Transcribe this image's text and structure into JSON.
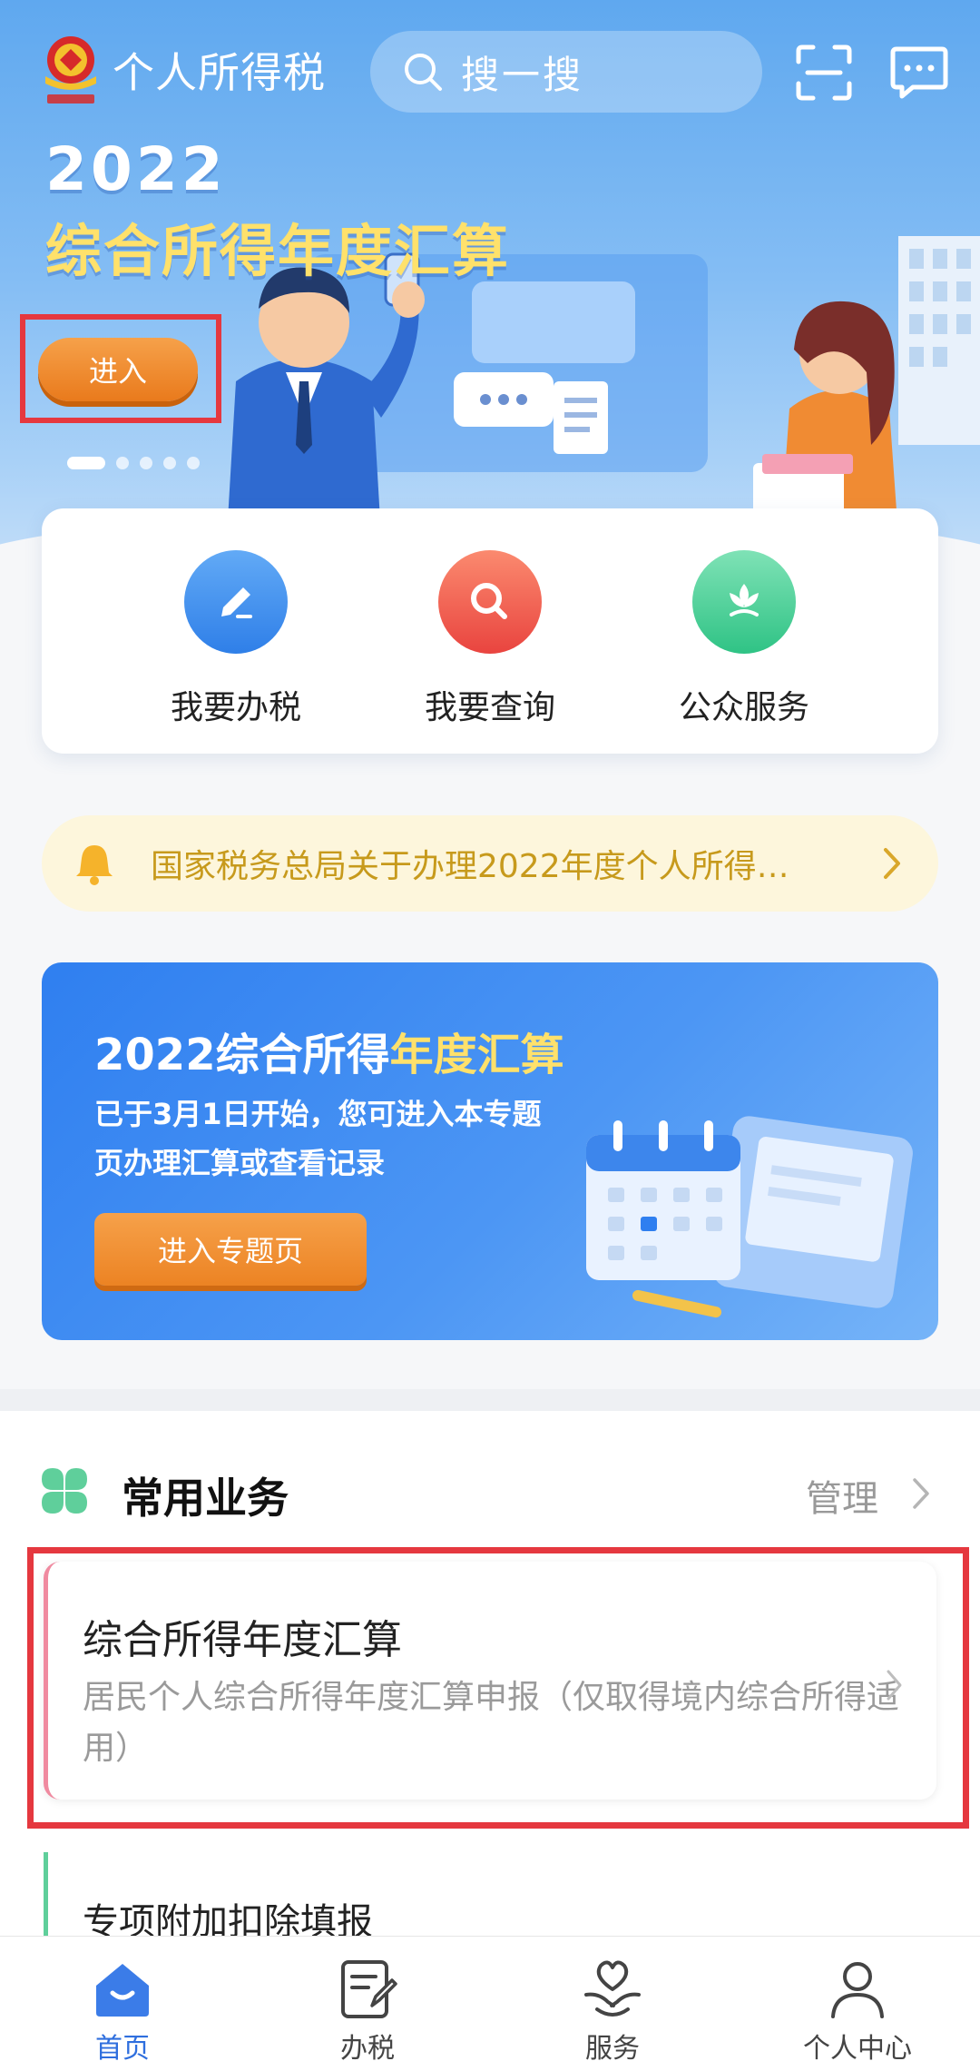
{
  "header": {
    "app_name": "个人所得税",
    "search_placeholder": "搜一搜"
  },
  "hero": {
    "year": "2022",
    "title": "综合所得年度汇算",
    "enter_label": "进入",
    "slide_count": 5,
    "active_slide": 1
  },
  "quick_actions": [
    {
      "label": "我要办税",
      "icon": "pencil-icon",
      "color": "#3f8ff0"
    },
    {
      "label": "我要查询",
      "icon": "magnifier-icon",
      "color": "#ef5b4f"
    },
    {
      "label": "公众服务",
      "icon": "flower-icon",
      "color": "#3ecf93"
    }
  ],
  "notice": {
    "text": "国家税务总局关于办理2022年度个人所得…"
  },
  "promo": {
    "title_prefix": "2022综合所得",
    "title_highlight": "年度汇算",
    "desc_line1": "已于3月1日开始，您可进入本专题",
    "desc_line2": "页办理汇算或查看记录",
    "button_label": "进入专题页"
  },
  "common": {
    "title": "常用业务",
    "manage_label": "管理",
    "items": [
      {
        "title": "综合所得年度汇算",
        "desc": "居民个人综合所得年度汇算申报（仅取得境内综合所得适用）"
      },
      {
        "title": "专项附加扣除填报"
      }
    ]
  },
  "tabs": [
    {
      "label": "首页",
      "active": true
    },
    {
      "label": "办税",
      "active": false
    },
    {
      "label": "服务",
      "active": false
    },
    {
      "label": "个人中心",
      "active": false
    }
  ],
  "colors": {
    "accent": "#2f6fde",
    "orange": "#ec8323",
    "highlight_red": "#e5383f",
    "notice_text": "#c79a1c"
  }
}
